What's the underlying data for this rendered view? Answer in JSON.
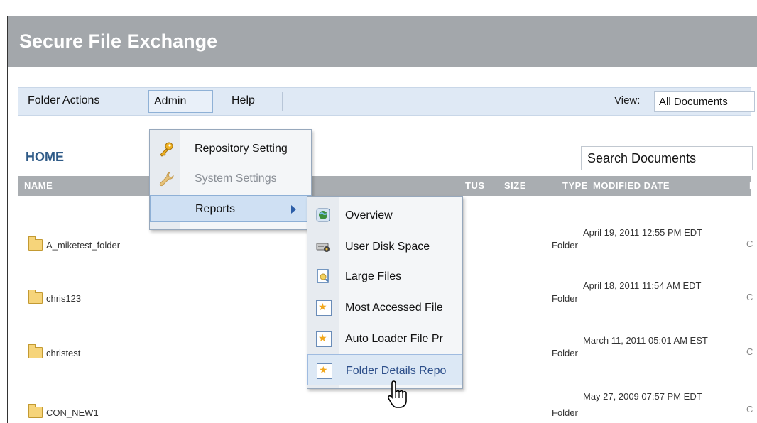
{
  "window": {
    "title": "Secure File Exchange"
  },
  "toolbar": {
    "folder_actions": "Folder Actions",
    "admin": "Admin",
    "help": "Help",
    "view_label": "View:",
    "view_value": "All Documents"
  },
  "breadcrumb": {
    "home": "HOME"
  },
  "search": {
    "placeholder": "Search Documents"
  },
  "table": {
    "headers": {
      "name": "NAME",
      "status": "TUS",
      "size": "SIZE",
      "type": "TYPE",
      "modified": "MODIFIED DATE",
      "last": "L"
    },
    "rows": [
      {
        "name": "A_miketest_folder",
        "type": "Folder",
        "modified": "April 19, 2011 12:55 PM EDT",
        "last": "C"
      },
      {
        "name": "chris123",
        "type": "Folder",
        "modified": "April 18, 2011 11:54 AM EDT",
        "last": "C"
      },
      {
        "name": "christest",
        "type": "Folder",
        "modified": "March 11, 2011 05:01 AM EST",
        "last": "C"
      },
      {
        "name": "CON_NEW1",
        "type": "Folder",
        "modified": "May 27, 2009 07:57 PM EDT",
        "last": "C"
      }
    ]
  },
  "admin_menu": {
    "items": [
      {
        "label": "Repository Setting",
        "icon": "key-icon"
      },
      {
        "label": "System Settings",
        "icon": "wrench-icon",
        "disabled": true
      },
      {
        "label": "Reports",
        "icon": "none"
      }
    ]
  },
  "reports_menu": {
    "items": [
      {
        "label": "Overview",
        "icon": "globe-icon"
      },
      {
        "label": "User Disk Space",
        "icon": "disk-icon"
      },
      {
        "label": "Large Files",
        "icon": "document-search-icon"
      },
      {
        "label": "Most Accessed File",
        "icon": "star-document-icon"
      },
      {
        "label": "Auto Loader File Pr",
        "icon": "star-document-icon"
      },
      {
        "label": "Folder Details Repo",
        "icon": "star-document-icon"
      }
    ]
  },
  "colors": {
    "titlebar": "#a3a7ab",
    "toolbar": "#dfe9f5",
    "header_row": "#a9adb1",
    "home_text": "#2e5a87"
  }
}
